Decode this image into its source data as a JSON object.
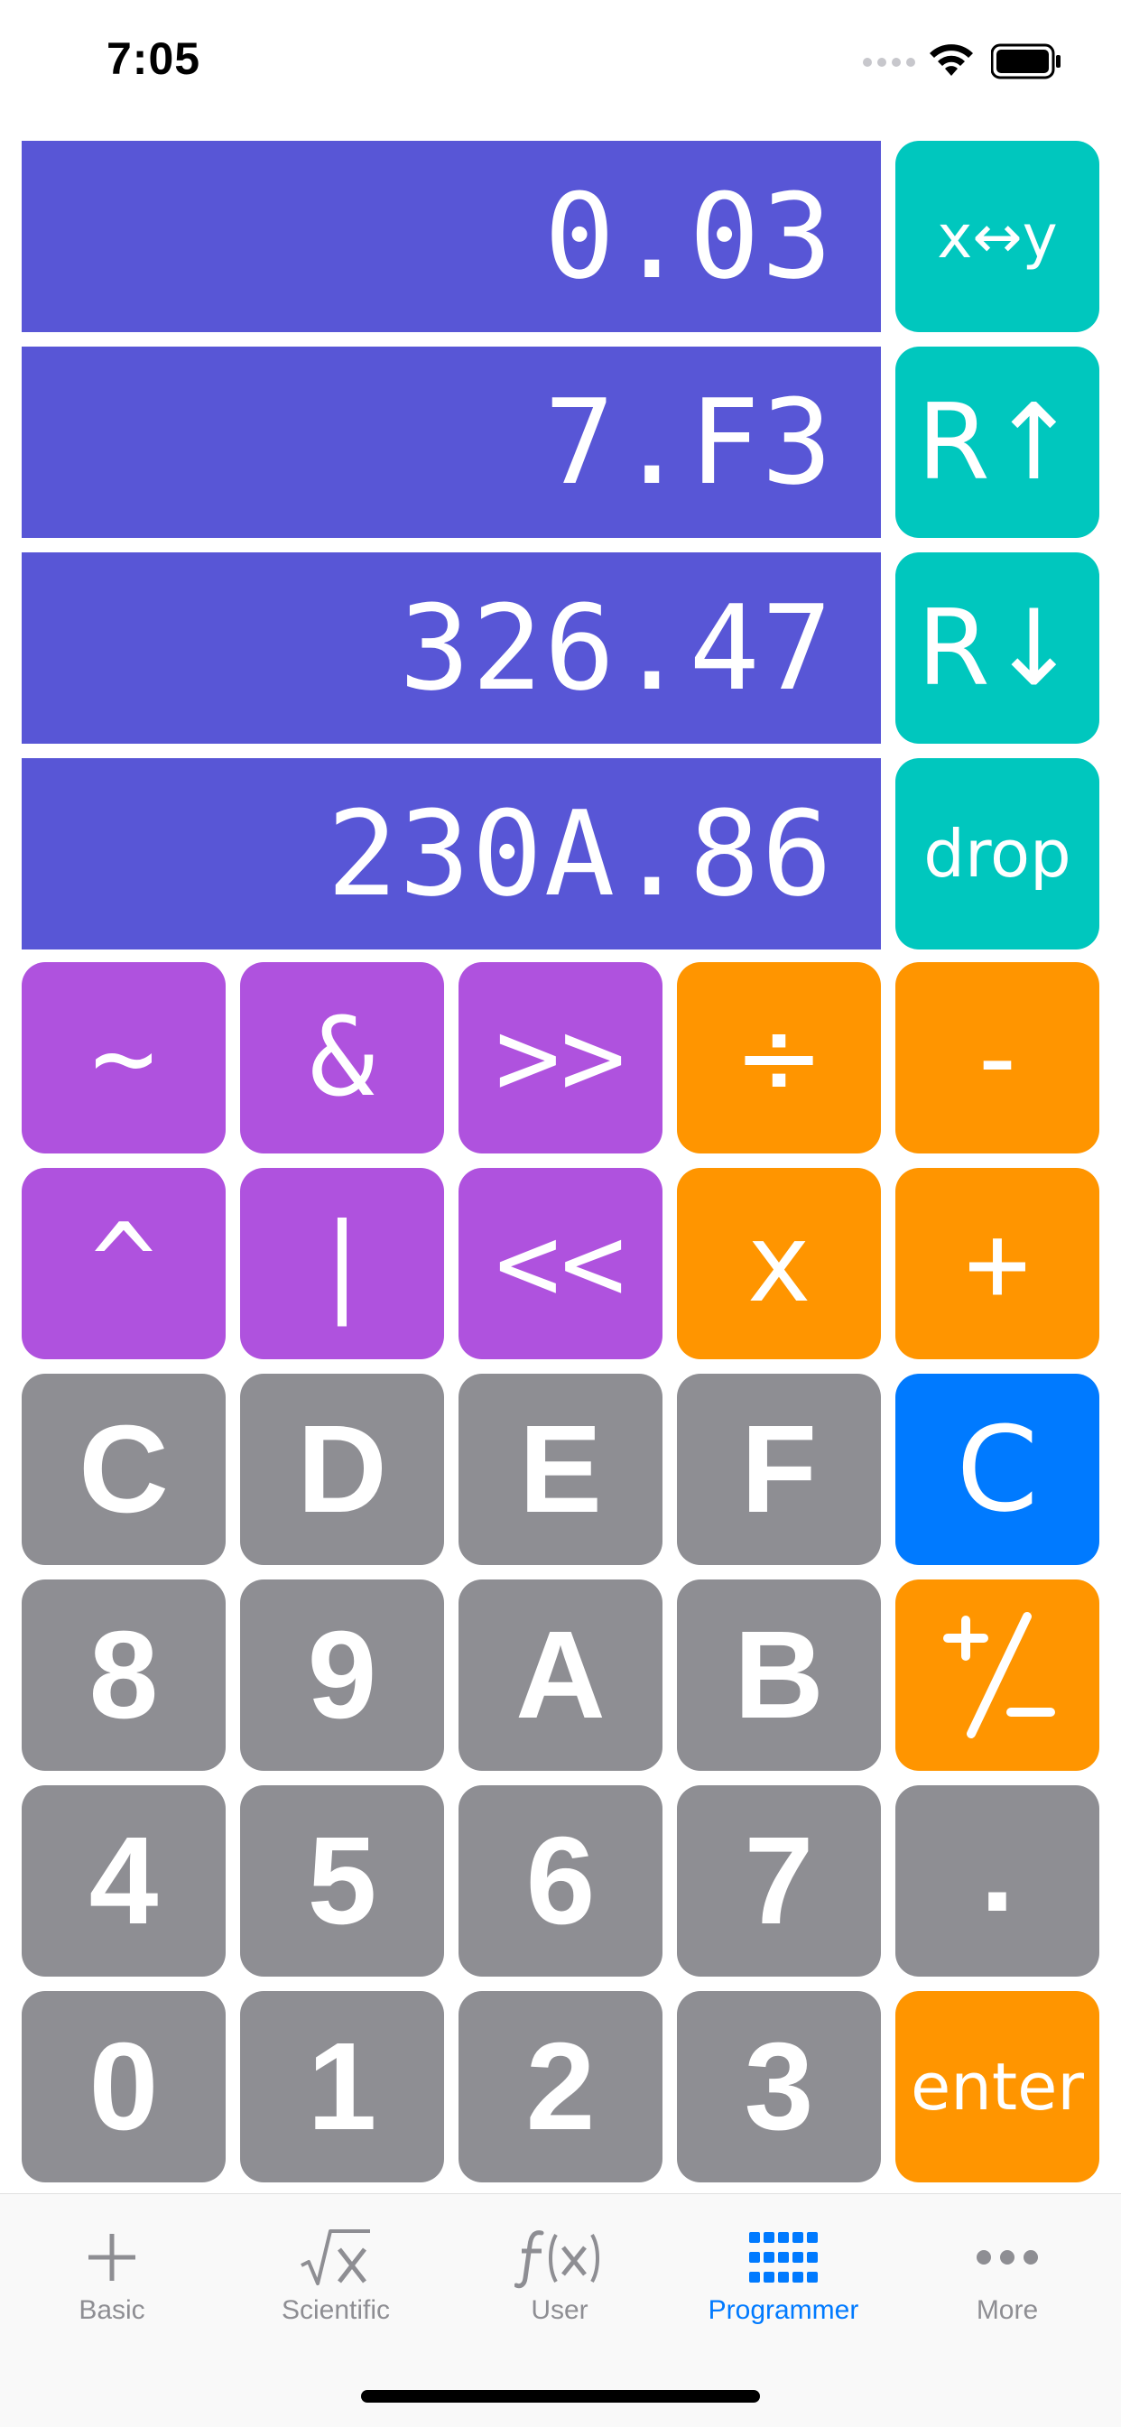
{
  "status_bar": {
    "time": "7:05"
  },
  "stack": {
    "rows": [
      "0.03",
      "7.F3",
      "326.47",
      "230A.86"
    ],
    "display_color": "#5856d6"
  },
  "stack_ops": {
    "swap": "x↔y",
    "roll_up": "R↑",
    "roll_down": "R↓",
    "drop": "drop"
  },
  "bitwise": {
    "not": "~",
    "and": "&",
    "shift_right": ">>",
    "xor": "^",
    "or": "|",
    "shift_left": "<<"
  },
  "operators": {
    "divide": "÷",
    "subtract": "-",
    "multiply": "x",
    "add": "+",
    "clear": "C",
    "sign": "+/−",
    "decimal": ".",
    "enter": "enter"
  },
  "digits": {
    "c": "C",
    "d": "D",
    "e": "E",
    "f": "F",
    "8": "8",
    "9": "9",
    "a": "A",
    "b": "B",
    "4": "4",
    "5": "5",
    "6": "6",
    "7": "7",
    "0": "0",
    "1": "1",
    "2": "2",
    "3": "3"
  },
  "tabs": [
    {
      "label": "Basic",
      "icon": "plus-icon",
      "active": false
    },
    {
      "label": "Scientific",
      "icon": "sqrt-x-icon",
      "active": false
    },
    {
      "label": "User",
      "icon": "function-icon",
      "active": false
    },
    {
      "label": "Programmer",
      "icon": "grid-icon",
      "active": true
    },
    {
      "label": "More",
      "icon": "ellipsis-icon",
      "active": false
    }
  ],
  "colors": {
    "teal": "#00c7be",
    "purple": "#af52de",
    "orange": "#ff9500",
    "gray": "#8e8e93",
    "blue": "#007aff"
  }
}
